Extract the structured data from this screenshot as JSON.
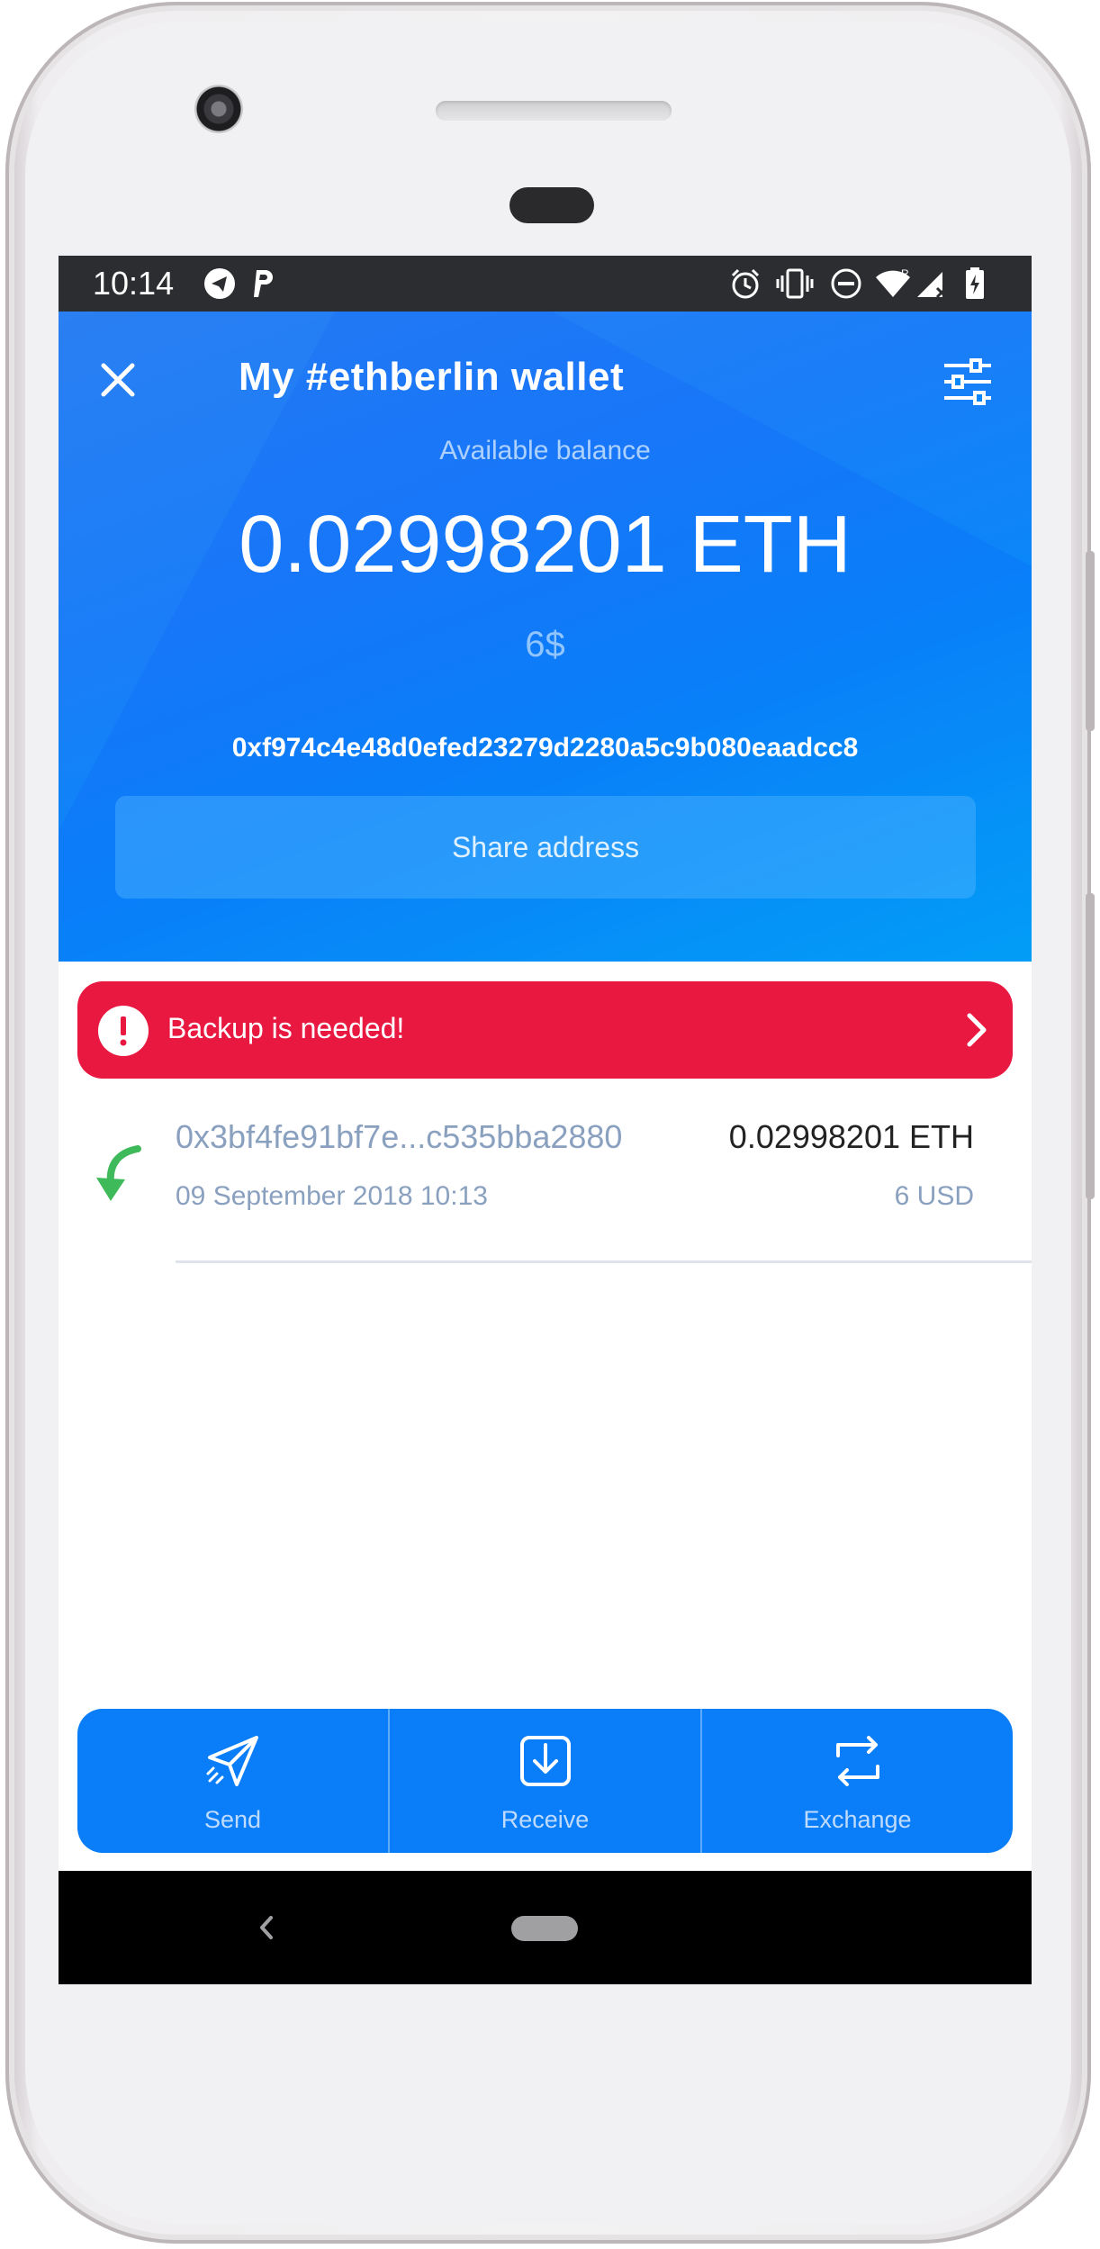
{
  "status_bar": {
    "time": "10:14"
  },
  "header": {
    "title": "My #ethberlin wallet",
    "balance_label": "Available balance",
    "balance": "0.02998201 ETH",
    "fiat": "6$",
    "address": "0xf974c4e48d0efed23279d2280a5c9b080eaadcc8",
    "share_label": "Share address"
  },
  "backup_banner": {
    "label": "Backup is needed!"
  },
  "transactions": [
    {
      "direction": "incoming",
      "address": "0x3bf4fe91bf7e...c535bba2880",
      "amount": "0.02998201 ETH",
      "date": "09 September 2018 10:13",
      "fiat": "6 USD"
    }
  ],
  "actions": [
    {
      "label": "Send",
      "icon": "send-icon"
    },
    {
      "label": "Receive",
      "icon": "receive-icon"
    },
    {
      "label": "Exchange",
      "icon": "exchange-icon"
    }
  ],
  "colors": {
    "header_gradient_start": "#2a7ff2",
    "header_gradient_end": "#03a9f7",
    "backup_red": "#e81840",
    "action_blue": "#0a7df8",
    "incoming_green": "#3fba5a",
    "muted_text": "#8aa0bf"
  }
}
